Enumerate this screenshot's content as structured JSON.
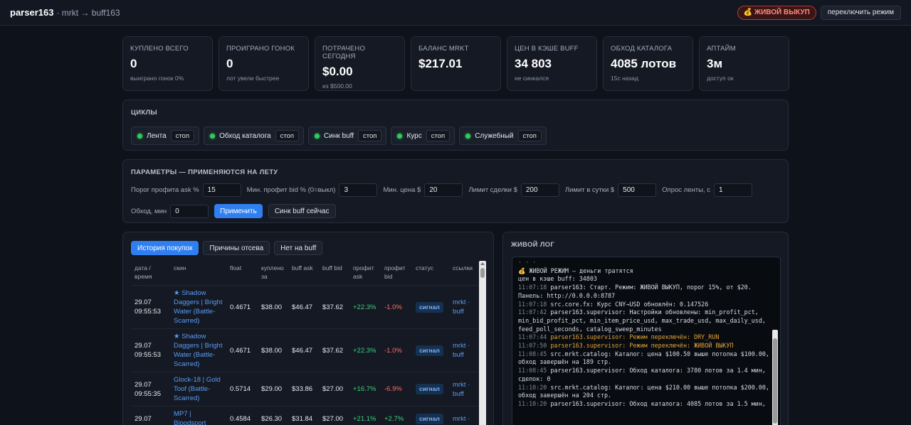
{
  "header": {
    "brand": "parser163",
    "subtitle": "· mrkt → buff163",
    "live_badge": "💰 ЖИВОЙ ВЫКУП",
    "switch_mode": "переключить режим"
  },
  "stats": [
    {
      "label": "Куплено всего",
      "value": "0",
      "sub": "выиграно гонок 0%"
    },
    {
      "label": "Проиграно гонок",
      "value": "0",
      "sub": "лот увели быстрее"
    },
    {
      "label": "Потрачено сегодня",
      "value": "$0.00",
      "sub": "из $500.00"
    },
    {
      "label": "Баланс mrkt",
      "value": "$217.01",
      "sub": ""
    },
    {
      "label": "Цен в кэше buff",
      "value": "34 803",
      "sub": "не синкался"
    },
    {
      "label": "Обход каталога",
      "value": "4085 лотов",
      "sub": "15с назад"
    },
    {
      "label": "Аптайм",
      "value": "3м",
      "sub": "доступ ок"
    }
  ],
  "cycles": {
    "title": "Циклы",
    "stop_label": "стоп",
    "items": [
      "Лента",
      "Обход каталога",
      "Синк buff",
      "Курс",
      "Служебный"
    ]
  },
  "params": {
    "title": "Параметры — применяются на лету",
    "fields": [
      {
        "label": "Порог профита ask %",
        "value": "15"
      },
      {
        "label": "Мин. профит bid % (0=выкл)",
        "value": "3"
      },
      {
        "label": "Мин. цена $",
        "value": "20"
      },
      {
        "label": "Лимит сделки $",
        "value": "200"
      },
      {
        "label": "Лимит в сутки $",
        "value": "500"
      },
      {
        "label": "Опрос ленты, с",
        "value": "1"
      },
      {
        "label": "Обход, мин",
        "value": "0"
      }
    ],
    "apply_label": "Применить",
    "sync_label": "Синк buff сейчас"
  },
  "history": {
    "tabs": [
      "История покупок",
      "Причины отсева",
      "Нет на buff"
    ],
    "columns": [
      "дата / время",
      "скин",
      "float",
      "куплено за",
      "buff ask",
      "buff bid",
      "профит ask",
      "профит bid",
      "статус",
      "ссылки"
    ],
    "rows": [
      {
        "date": "29.07",
        "time": "09:55:53",
        "skin": "★ Shadow Daggers | Bright Water (Battle-Scarred)",
        "float": "0.4671",
        "bought": "$38.00",
        "ask": "$46.47",
        "bid": "$37.62",
        "pask": "+22.3%",
        "pbid": "-1.0%",
        "status": "сигнал",
        "links": "mrkt · buff"
      },
      {
        "date": "29.07",
        "time": "09:55:53",
        "skin": "★ Shadow Daggers | Bright Water (Battle-Scarred)",
        "float": "0.4671",
        "bought": "$38.00",
        "ask": "$46.47",
        "bid": "$37.62",
        "pask": "+22.3%",
        "pbid": "-1.0%",
        "status": "сигнал",
        "links": "mrkt · buff"
      },
      {
        "date": "29.07",
        "time": "09:55:35",
        "skin": "Glock-18 | Gold Toof (Battle-Scarred)",
        "float": "0.5714",
        "bought": "$29.00",
        "ask": "$33.86",
        "bid": "$27.00",
        "pask": "+16.7%",
        "pbid": "-6.9%",
        "status": "сигнал",
        "links": "mrkt · buff"
      },
      {
        "date": "29.07",
        "time": "",
        "skin": "MP7 | Bloodsport",
        "float": "0.4584",
        "bought": "$26.30",
        "ask": "$31.84",
        "bid": "$27.00",
        "pask": "+21.1%",
        "pbid": "+2.7%",
        "status": "сигнал",
        "links": "mrkt ·"
      }
    ]
  },
  "live_log": {
    "title": "Живой лог",
    "lines": [
      {
        "t": "",
        "text": "💰 ЖИВОЙ РЕЖИМ — деньги тратятся",
        "kind": "plain"
      },
      {
        "t": "",
        "text": "цен в кэше buff: 34803",
        "kind": "plain"
      },
      {
        "t": "11:07:18",
        "text": "parser163: Старт. Режим: ЖИВОЙ ВЫКУП, порог 15%, от $20. Панель: http://0.0.0.0:8787",
        "kind": "plain"
      },
      {
        "t": "11:07:18",
        "text": "src.core.fx: Курс CNY→USD обновлён: 0.147526",
        "kind": "plain"
      },
      {
        "t": "11:07:42",
        "text": "parser163.supervisor: Настройки обновлены: min_profit_pct, min_bid_profit_pct, min_item_price_usd, max_trade_usd, max_daily_usd, feed_poll_seconds, catalog_sweep_minutes",
        "kind": "plain"
      },
      {
        "t": "11:07:44",
        "text": "parser163.supervisor: Режим переключён: DRY_RUN",
        "kind": "warn"
      },
      {
        "t": "11:07:50",
        "text": "parser163.supervisor: Режим переключён: ЖИВОЙ ВЫКУП",
        "kind": "warn"
      },
      {
        "t": "11:08:45",
        "text": "src.mrkt.catalog: Каталог: цена $100.50 выше потолка $100.00, обход завершён на 189 стр.",
        "kind": "plain"
      },
      {
        "t": "11:08:45",
        "text": "parser163.supervisor: Обход каталога: 3780 лотов за 1.4 мин, сделок: 0",
        "kind": "plain"
      },
      {
        "t": "11:10:20",
        "text": "src.mrkt.catalog: Каталог: цена $210.00 выше потолка $200.00, обход завершён на 204 стр.",
        "kind": "plain"
      },
      {
        "t": "11:10:20",
        "text": "parser163.supervisor: Обход каталога: 4085 лотов за 1.5 мин,",
        "kind": "plain"
      }
    ]
  },
  "colors": {
    "accent": "#2f7ff0",
    "ok": "#2fcc5b",
    "positive": "#3dd17a",
    "negative": "#ff6b6b",
    "warn": "#e0a23a"
  }
}
